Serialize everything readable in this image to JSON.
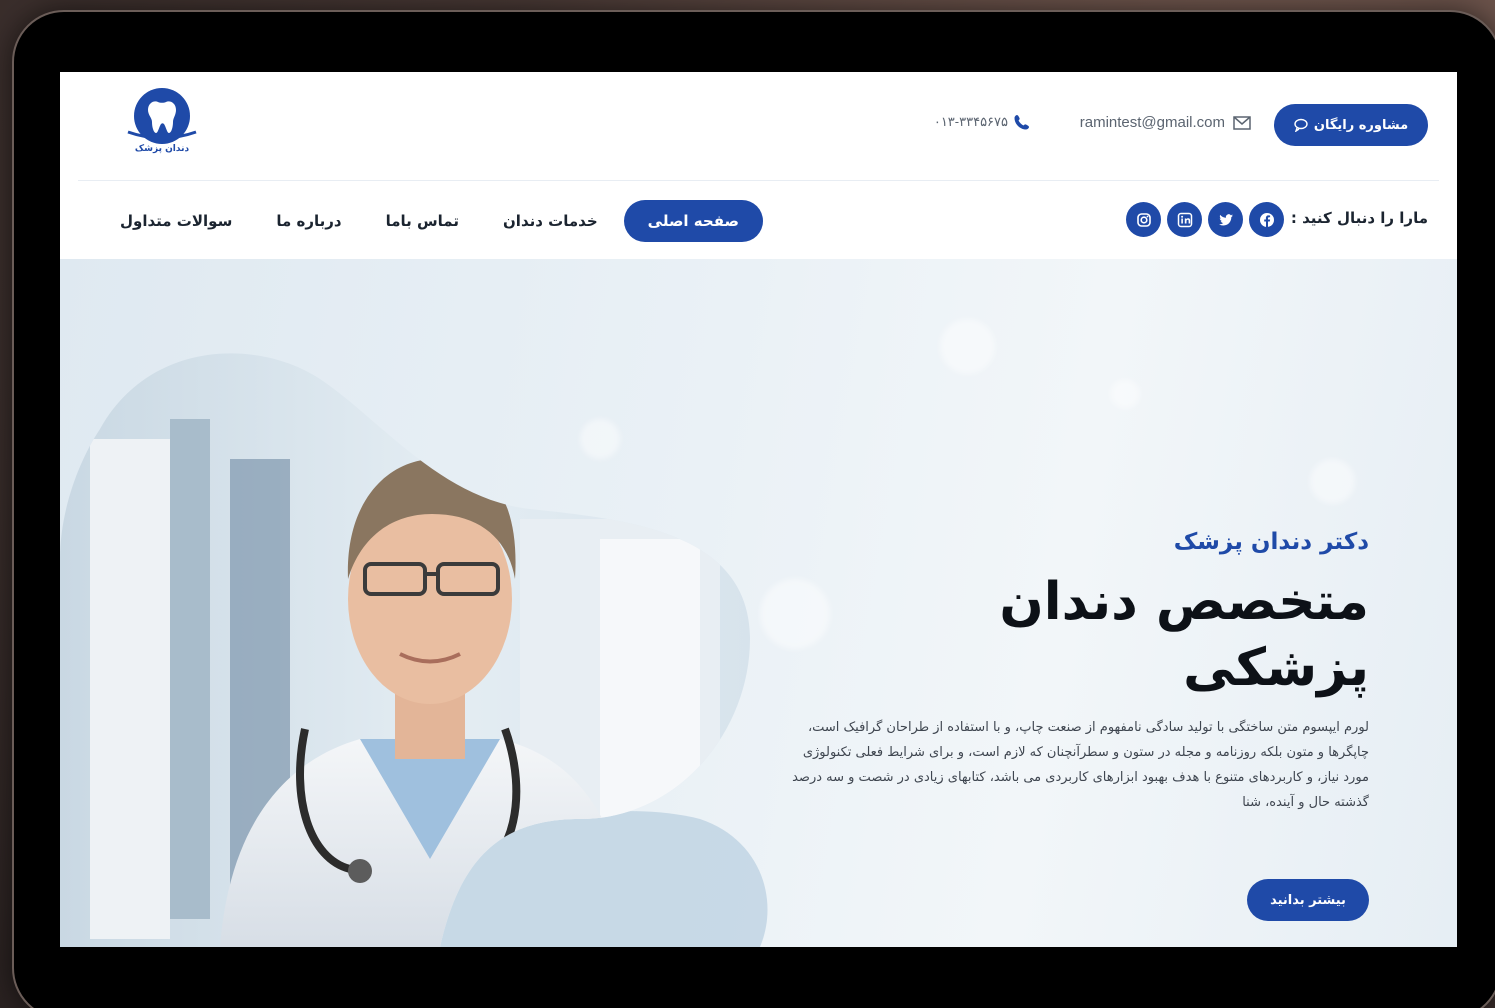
{
  "header": {
    "logo_text": "دندان پزشک",
    "consult_label": "مشاوره رایگان",
    "email": "ramintest@gmail.com",
    "phone": "۰۱۳-۳۳۴۵۶۷۵"
  },
  "nav": {
    "follow_label": "مارا را دنبال کنید :",
    "items": [
      {
        "label": "صفحه اصلی",
        "active": true
      },
      {
        "label": "خدمات دندان",
        "active": false
      },
      {
        "label": "تماس باما",
        "active": false
      },
      {
        "label": "درباره ما",
        "active": false
      },
      {
        "label": "سوالات متداول",
        "active": false
      }
    ],
    "socials": [
      "facebook-icon",
      "twitter-icon",
      "linkedin-icon",
      "instagram-icon"
    ]
  },
  "hero": {
    "subtitle": "دکتر دندان پزشک",
    "title_line1": "متخصص دندان",
    "title_line2": "پزشکی",
    "description": "لورم ایپسوم متن ساختگی با تولید سادگی نامفهوم از صنعت چاپ، و با استفاده از طراحان گرافیک است، چاپگرها و متون بلکه روزنامه و مجله در ستون و سطرآنچنان که لازم است، و برای شرایط فعلی تکنولوژی مورد نیاز، و کاربردهای متنوع با هدف بهبود ابزارهای کاربردی می باشد، کتابهای زیادی در شصت و سه درصد گذشته حال و آینده، شنا",
    "cta_label": "بیشتر بدانید"
  },
  "colors": {
    "brand": "#1f4aa8",
    "text": "#1b2430"
  }
}
